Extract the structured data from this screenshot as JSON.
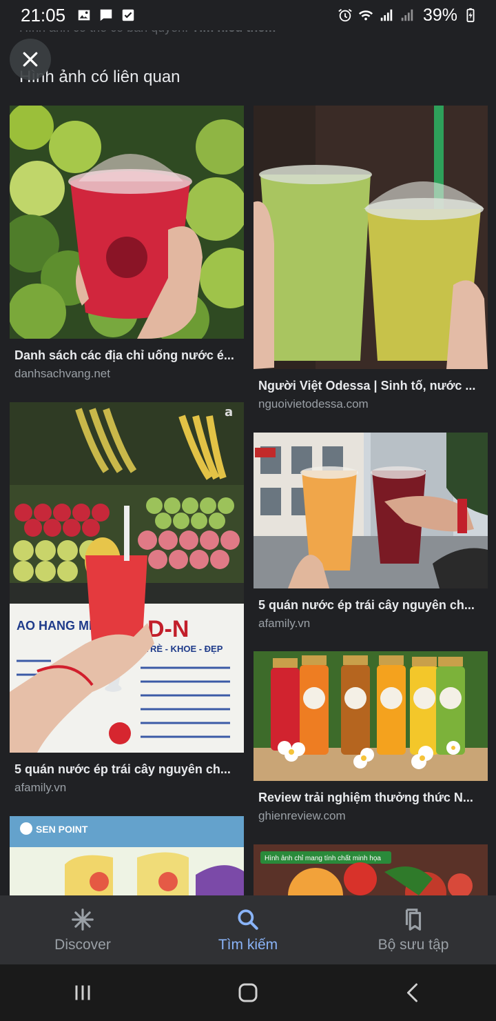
{
  "status": {
    "time": "21:05",
    "battery": "39%",
    "left_icons": [
      "image-icon",
      "message-icon",
      "checkbox-icon"
    ],
    "right_icons": [
      "alarm-icon",
      "wifi-icon",
      "signal-icon",
      "signal-icon",
      "battery-icon"
    ]
  },
  "header": {
    "copyright_prefix": "Hình ảnh có thể có bản quyền.",
    "copyright_link": "Tìm hiểu thêm",
    "section_title": "Hình ảnh có liên quan"
  },
  "results": [
    {
      "title": "Danh sách các địa chỉ uống nước é...",
      "source": "danhsachvang.net"
    },
    {
      "title": "Người Việt Odessa | Sinh tố, nước ...",
      "source": "nguoivietodessa.com"
    },
    {
      "title": "5 quán nước ép trái cây nguyên ch...",
      "source": "afamily.vn"
    },
    {
      "title": "5 quán nước ép trái cây nguyên ch...",
      "source": "afamily.vn"
    },
    {
      "title": "Review trải nghiệm thưởng thức N...",
      "source": "ghienreview.com"
    },
    {
      "title": "",
      "source": ""
    },
    {
      "title": "",
      "source": ""
    }
  ],
  "image_texts": {
    "fruit_stand_sign": "TRÈ - KHOE - ĐẸP",
    "senpoint_logo": "SEN POINT",
    "illustration_note": "Hình ảnh chỉ mang tính chất minh họa"
  },
  "bottom_nav": {
    "items": [
      {
        "label": "Discover",
        "icon": "asterisk-icon",
        "active": false
      },
      {
        "label": "Tìm kiếm",
        "icon": "search-icon",
        "active": true
      },
      {
        "label": "Bộ sưu tập",
        "icon": "collections-icon",
        "active": false
      }
    ]
  },
  "colors": {
    "background": "#202124",
    "accent": "#8ab4f8",
    "secondary_text": "#9aa0a6"
  }
}
